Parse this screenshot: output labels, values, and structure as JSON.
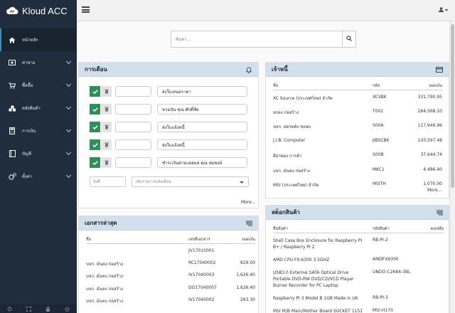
{
  "brand": {
    "name": "Kloud ACC"
  },
  "sidebar": {
    "items": [
      {
        "label": "หน้าหลัก",
        "icon": "home-icon",
        "active": true,
        "chevron": false
      },
      {
        "label": "ค่าขาย",
        "icon": "cash-icon",
        "active": false,
        "chevron": true
      },
      {
        "label": "ซื้อขื้อ",
        "icon": "cart-icon",
        "active": false,
        "chevron": true
      },
      {
        "label": "คลังสินค้า",
        "icon": "cubes-icon",
        "active": false,
        "chevron": true
      },
      {
        "label": "การเงิน",
        "icon": "calculator-icon",
        "active": false,
        "chevron": true
      },
      {
        "label": "บัญชี",
        "icon": "book-icon",
        "active": false,
        "chevron": true
      },
      {
        "label": "ตั้งค่า",
        "icon": "cogs-icon",
        "active": false,
        "chevron": true
      }
    ]
  },
  "search": {
    "placeholder": "ค้นหา..."
  },
  "reminders": {
    "title": "การเตือน",
    "items": [
      {
        "text": "ส่งใบเสนอราคา"
      },
      {
        "text": "ทวงเงิน คุณ ศักดิ์ชัย"
      },
      {
        "text": "ส่งใบแจ้งหนี้"
      },
      {
        "text": "ส่งใบแจ้งหนี้"
      },
      {
        "text": "ชำระเงินค่าอะตอมล คุณ สมพงษ์"
      }
    ],
    "date_placeholder": "วันที่",
    "text_placeholder": "เพิ่มรายการแจ้งเตือน",
    "more": "More..."
  },
  "documents": {
    "title": "เอกสารล่าสุด",
    "headers": {
      "name": "ชื่อ",
      "number": "เลขที่เอกสาร",
      "amount": "ยอดเงิน"
    },
    "rows": [
      {
        "name": "",
        "number": "JV17010001",
        "amount": ""
      },
      {
        "name": "บจก. มั่นคง ก่อสร้าง",
        "number": "RC17040002",
        "amount": "829.00"
      },
      {
        "name": "บจก. มั่นคง ก่อสร้าง",
        "number": "IV17040003",
        "amount": "1,626.40"
      },
      {
        "name": "บจก. มั่นคง ก่อสร้าง",
        "number": "DO17040007",
        "amount": "1,626.40"
      },
      {
        "name": "บจก. มั่นคง ก่อสร้าง",
        "number": "IV17040002",
        "amount": "263.30"
      }
    ]
  },
  "creditors": {
    "title": "เจ้าหนี้",
    "headers": {
      "name": "ชื่อ",
      "code": "รหัส",
      "balance": "ยอดเงิน"
    },
    "rows": [
      {
        "name": "XC Source (ประเทศไทย) จำกัด",
        "code": "XCSBK",
        "balance": "331,790.95"
      },
      {
        "name": "ทรอง ก่อสร้าง",
        "code": "T002",
        "balance": "264,568.10"
      },
      {
        "name": "หจก. สตรพลัง ซอฟง",
        "code": "S00A",
        "balance": "117,949.96"
      },
      {
        "name": "J.I.B. Computer",
        "code": "JIBSCBK",
        "balance": "103,597.48"
      },
      {
        "name": "สีอาพอง การค้า",
        "code": "S00B",
        "balance": "37,644.74"
      },
      {
        "name": "บจก. มั่นคง ก่อสร้าง",
        "code": "MKC1",
        "balance": "4,486.40"
      },
      {
        "name": "MSI (ประเทศไทย) จำกัด",
        "code": "MSITH",
        "balance": "1,070.00"
      }
    ],
    "more": "More..."
  },
  "stock": {
    "title": "สต็อกสินค้า",
    "headers": {
      "name": "ชื่อสินค้า",
      "code": "รหัสสินค้า",
      "remain": "คงเหลือ"
    },
    "rows": [
      {
        "name": "Shell Case Box Enclosure for Raspberry PI B+ / Raspberry PI 2",
        "code": "RB-PI-2"
      },
      {
        "name": "AMD CPU FX-6300 3.5GHZ",
        "code": "AMDFX6300"
      },
      {
        "name": "USB3.0 External SATA Optical Drive Portable DVD-RW DVD/CD/VCD Player Burner Recorder for PC Laptop",
        "code": "UNDO-C2684-3BL"
      },
      {
        "name": "Raspberry PI 3 Model B 1GB Made in UK",
        "code": "RB-PI-3"
      },
      {
        "name": "MSI M/B Main/Mother Board SOCKET 1151",
        "code": "MSI-H170"
      }
    ]
  },
  "colors": {
    "sidebar": "#1f2d3d",
    "panel_header": "#d2e0ee",
    "check": "#2f8f5b"
  }
}
